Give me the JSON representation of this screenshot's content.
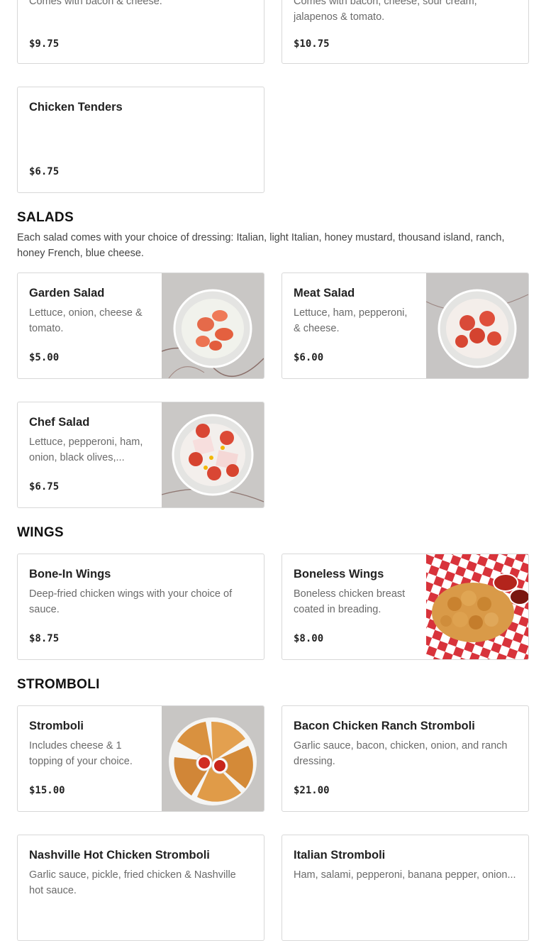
{
  "top_cards": [
    {
      "desc": "Comes with bacon & cheese.",
      "price": "$9.75"
    },
    {
      "desc": "Comes with bacon, cheese, sour cream, jalapenos & tomato.",
      "price": "$10.75"
    }
  ],
  "chicken_tenders": {
    "name": "Chicken Tenders",
    "price": "$6.75"
  },
  "salads": {
    "title": "SALADS",
    "description": "Each salad comes with your choice of dressing: Italian, light Italian, honey mustard, thousand island, ranch, honey French, blue cheese.",
    "items": [
      {
        "name": "Garden Salad",
        "desc": "Lettuce, onion, cheese & tomato.",
        "price": "$5.00"
      },
      {
        "name": "Meat Salad",
        "desc": "Lettuce, ham, pepperoni, & cheese.",
        "price": "$6.00"
      },
      {
        "name": "Chef Salad",
        "desc": "Lettuce, pepperoni, ham, onion, black olives,...",
        "price": "$6.75"
      }
    ]
  },
  "wings": {
    "title": "WINGS",
    "items": [
      {
        "name": "Bone-In Wings",
        "desc": "Deep-fried chicken wings with your choice of sauce.",
        "price": "$8.75"
      },
      {
        "name": "Boneless Wings",
        "desc": "Boneless chicken breast coated in breading.",
        "price": "$8.00"
      }
    ]
  },
  "stromboli": {
    "title": "STROMBOLI",
    "items": [
      {
        "name": "Stromboli",
        "desc": "Includes cheese & 1 topping of your choice.",
        "price": "$15.00"
      },
      {
        "name": "Bacon Chicken Ranch Stromboli",
        "desc": "Garlic sauce, bacon, chicken, onion, and ranch dressing.",
        "price": "$21.00"
      },
      {
        "name": "Nashville Hot Chicken Stromboli",
        "desc": "Garlic sauce, pickle, fried chicken & Nashville hot sauce.",
        "price": ""
      },
      {
        "name": "Italian Stromboli",
        "desc": "Ham, salami, pepperoni, banana pepper, onion...",
        "price": ""
      }
    ]
  }
}
